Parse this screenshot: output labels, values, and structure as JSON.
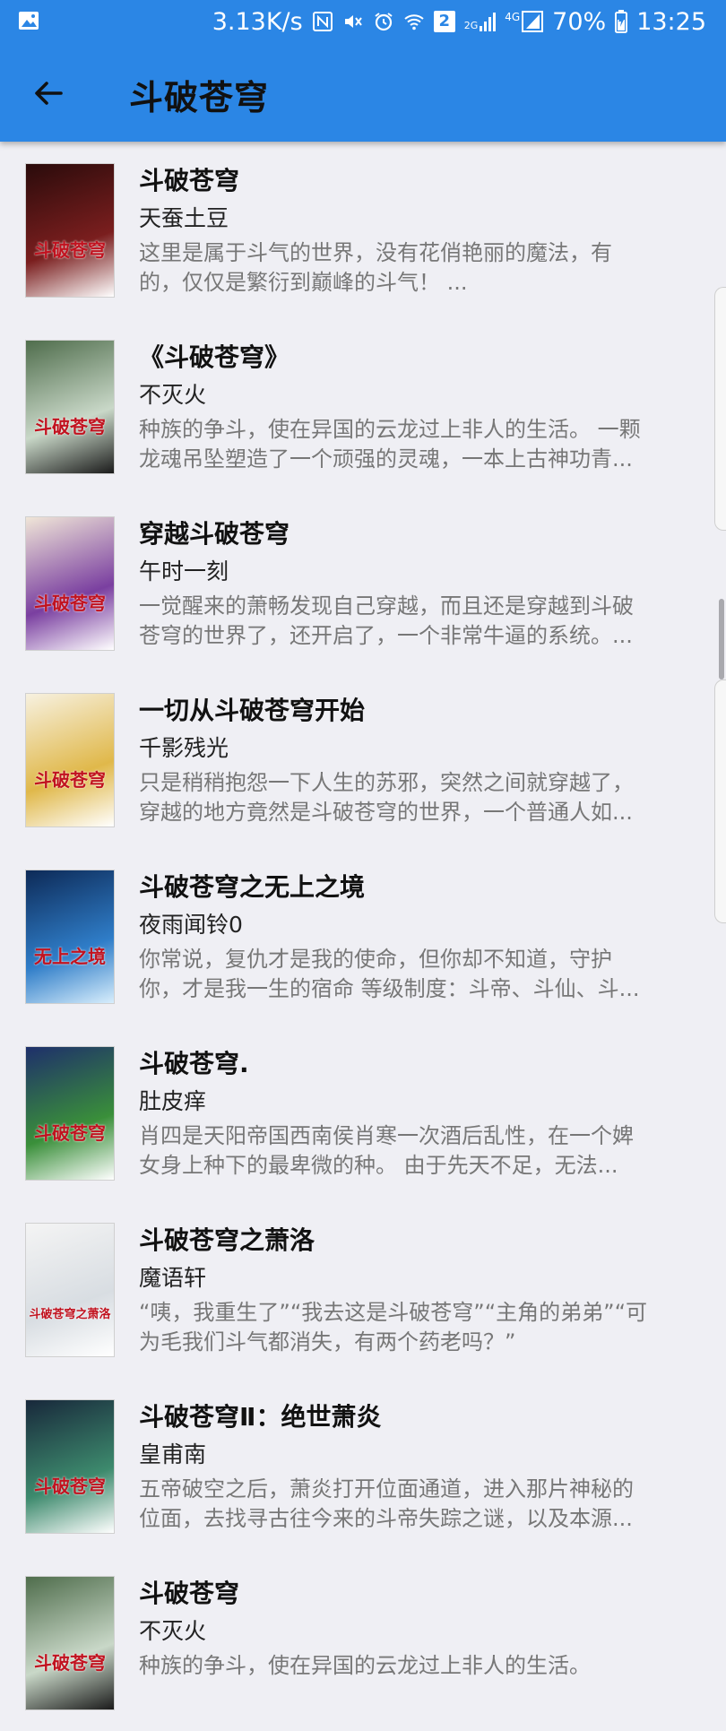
{
  "status_bar": {
    "speed": "3.13K/s",
    "battery": "70%",
    "time": "13:25",
    "sim_label": "2",
    "network_label": "4G",
    "network_2g": "2G",
    "icons": [
      "gallery-icon",
      "nfc-icon",
      "mute-icon",
      "alarm-icon",
      "wifi-icon",
      "sim2-icon",
      "signal-icon",
      "signal-4g-icon",
      "battery-charging-icon"
    ]
  },
  "app_bar": {
    "title": "斗破苍穹",
    "back_icon": "arrow-left-icon",
    "color": "#2b86e5"
  },
  "books": [
    {
      "title": "斗破苍穹",
      "author": "天蚕土豆",
      "desc1": "这里是属于斗气的世界，没有花俏艳丽的魔法，有",
      "desc2": "的，仅仅是繁衍到巅峰的斗气！ ...",
      "cover_text": "斗破苍穹"
    },
    {
      "title": "《斗破苍穹》",
      "author": "不灭火",
      "desc1": "种族的争斗，使在异国的云龙过上非人的生活。 一颗",
      "desc2": "龙魂吊坠塑造了一个顽强的灵魂，一本上古神功青...",
      "cover_text": "斗破苍穹"
    },
    {
      "title": "穿越斗破苍穹",
      "author": "午时一刻",
      "desc1": "一觉醒来的萧畅发现自己穿越，而且还是穿越到斗破",
      "desc2": "苍穹的世界了，还开启了，一个非常牛逼的系统。...",
      "cover_text": "斗破苍穹"
    },
    {
      "title": "一切从斗破苍穹开始",
      "author": "千影残光",
      "desc1": "只是稍稍抱怨一下人生的苏邪，突然之间就穿越了，",
      "desc2": "穿越的地方竟然是斗破苍穹的世界，一个普通人如...",
      "cover_text": "斗破苍穹"
    },
    {
      "title": "斗破苍穹之无上之境",
      "author": "夜雨闻铃0",
      "desc1": "你常说，复仇才是我的使命，但你却不知道，守护",
      "desc2": "你，才是我一生的宿命 等级制度：斗帝、斗仙、斗...",
      "cover_text": "无上之境"
    },
    {
      "title": "斗破苍穹.",
      "author": "肚皮痒",
      "desc1": "肖四是天阳帝国西南侯肖寒一次酒后乱性，在一个婢",
      "desc2": "女身上种下的最卑微的种。    由于先天不足，无法...",
      "cover_text": "斗破苍穹"
    },
    {
      "title": "斗破苍穹之萧洛",
      "author": "魔语轩",
      "desc1": "“咦，我重生了”“我去这是斗破苍穹”“主角的弟弟”“可",
      "desc2": "为毛我们斗气都消失，有两个药老吗？”",
      "cover_text": "斗破苍穹之萧洛"
    },
    {
      "title": "斗破苍穹Ⅱ：绝世萧炎",
      "author": "皇甫南",
      "desc1": "五帝破空之后，萧炎打开位面通道，进入那片神秘的",
      "desc2": "位面，去找寻古往今来的斗帝失踪之谜，以及本源...",
      "cover_text": "斗破苍穹"
    },
    {
      "title": "斗破苍穹",
      "author": "不灭火",
      "desc1": "种族的争斗，使在异国的云龙过上非人的生活。",
      "desc2": "",
      "cover_text": "斗破苍穹"
    }
  ]
}
